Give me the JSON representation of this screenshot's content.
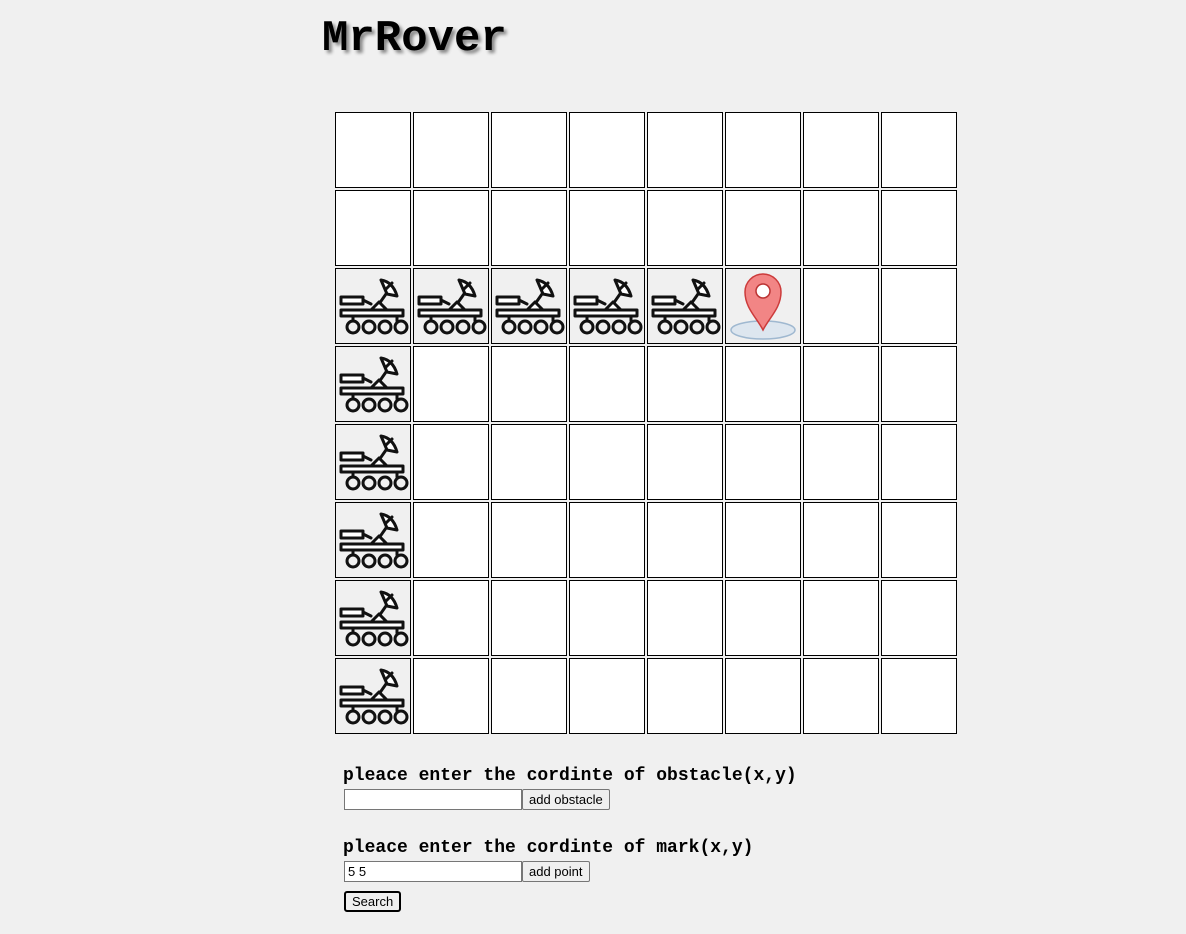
{
  "app": {
    "title": "MrRover"
  },
  "grid": {
    "size": 8,
    "rover_icon": "rover-icon",
    "mark_icon": "map-pin-icon",
    "rover_cells": [
      [
        2,
        0
      ],
      [
        2,
        1
      ],
      [
        2,
        2
      ],
      [
        2,
        3
      ],
      [
        2,
        4
      ],
      [
        3,
        0
      ],
      [
        4,
        0
      ],
      [
        5,
        0
      ],
      [
        6,
        0
      ],
      [
        7,
        0
      ]
    ],
    "mark_cell": [
      2,
      5
    ],
    "mark_color": "#f28585"
  },
  "obstacle_form": {
    "label": "pleace enter the cordinte of obstacle(x,y)",
    "value": "",
    "placeholder": "",
    "button_label": "add obstacle"
  },
  "mark_form": {
    "label": "pleace enter the cordinte of mark(x,y)",
    "value": "5 5",
    "placeholder": "",
    "button_label": "add point"
  },
  "search_button_label": "Search"
}
